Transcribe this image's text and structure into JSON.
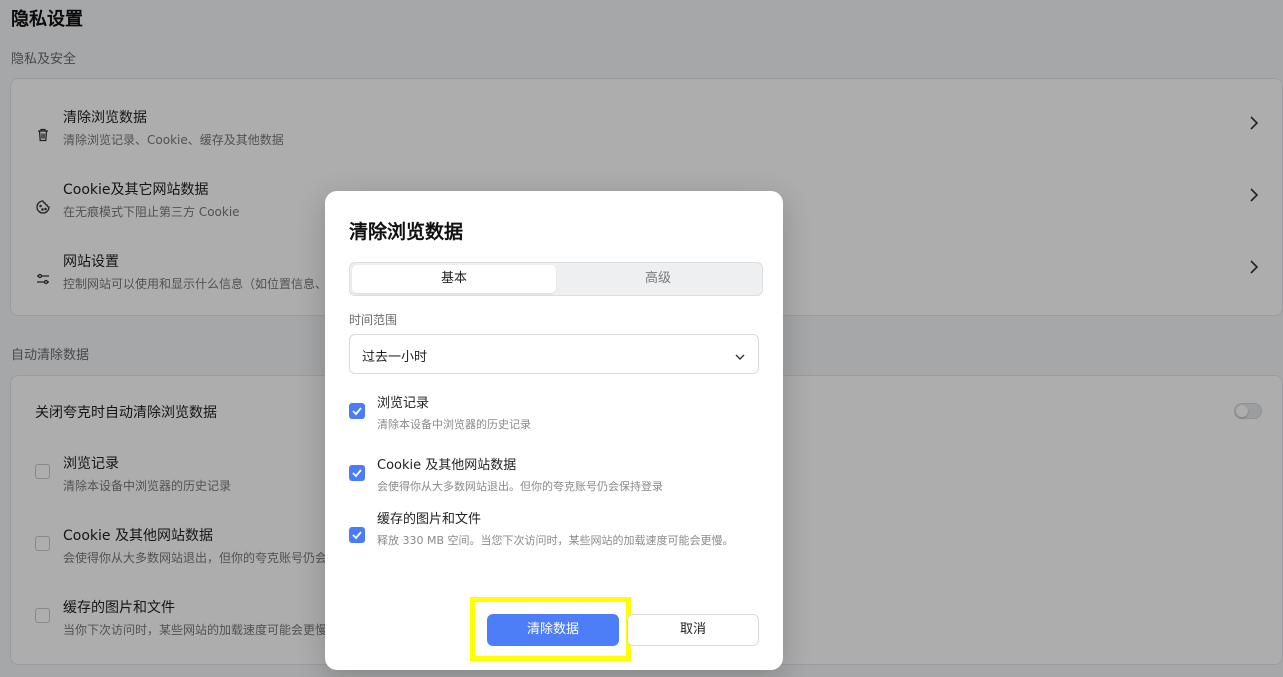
{
  "page": {
    "title": "隐私设置",
    "section_privacy": "隐私及安全",
    "section_auto": "自动清除数据"
  },
  "privacy_items": [
    {
      "title": "清除浏览数据",
      "desc": "清除浏览记录、Cookie、缓存及其他数据",
      "icon": "trash-icon"
    },
    {
      "title": "Cookie及其它网站数据",
      "desc": "在无痕模式下阻止第三方 Cookie",
      "icon": "cookie-icon"
    },
    {
      "title": "网站设置",
      "desc": "控制网站可以使用和显示什么信息（如位置信息、",
      "icon": "sliders-icon"
    }
  ],
  "auto_clear": {
    "title": "关闭夸克时自动清除浏览数据",
    "toggle_on": false,
    "items": [
      {
        "title": "浏览记录",
        "desc": "清除本设备中浏览器的历史记录",
        "checked": false
      },
      {
        "title": "Cookie 及其他网站数据",
        "desc": "会使得你从大多数网站退出，但你的夸克账号仍会",
        "checked": false
      },
      {
        "title": "缓存的图片和文件",
        "desc": "当你下次访问时，某些网站的加载速度可能会更慢",
        "checked": false
      }
    ]
  },
  "dialog": {
    "title": "清除浏览数据",
    "tabs": [
      {
        "label": "基本",
        "active": true
      },
      {
        "label": "高级",
        "active": false
      }
    ],
    "time_range_label": "时间范围",
    "time_range_value": "过去一小时",
    "options": [
      {
        "title": "浏览记录",
        "desc": "清除本设备中浏览器的历史记录",
        "checked": true
      },
      {
        "title": "Cookie 及其他网站数据",
        "desc": "会使得你从大多数网站退出。但你的夸克账号仍会保持登录",
        "checked": true
      },
      {
        "title": "缓存的图片和文件",
        "desc": "释放 330 MB 空间。当您下次访问时，某些网站的加载速度可能会更慢。",
        "checked": true
      }
    ],
    "confirm_label": "清除数据",
    "cancel_label": "取消"
  },
  "colors": {
    "accent": "#4d7ef7",
    "highlight": "#ffff00"
  }
}
